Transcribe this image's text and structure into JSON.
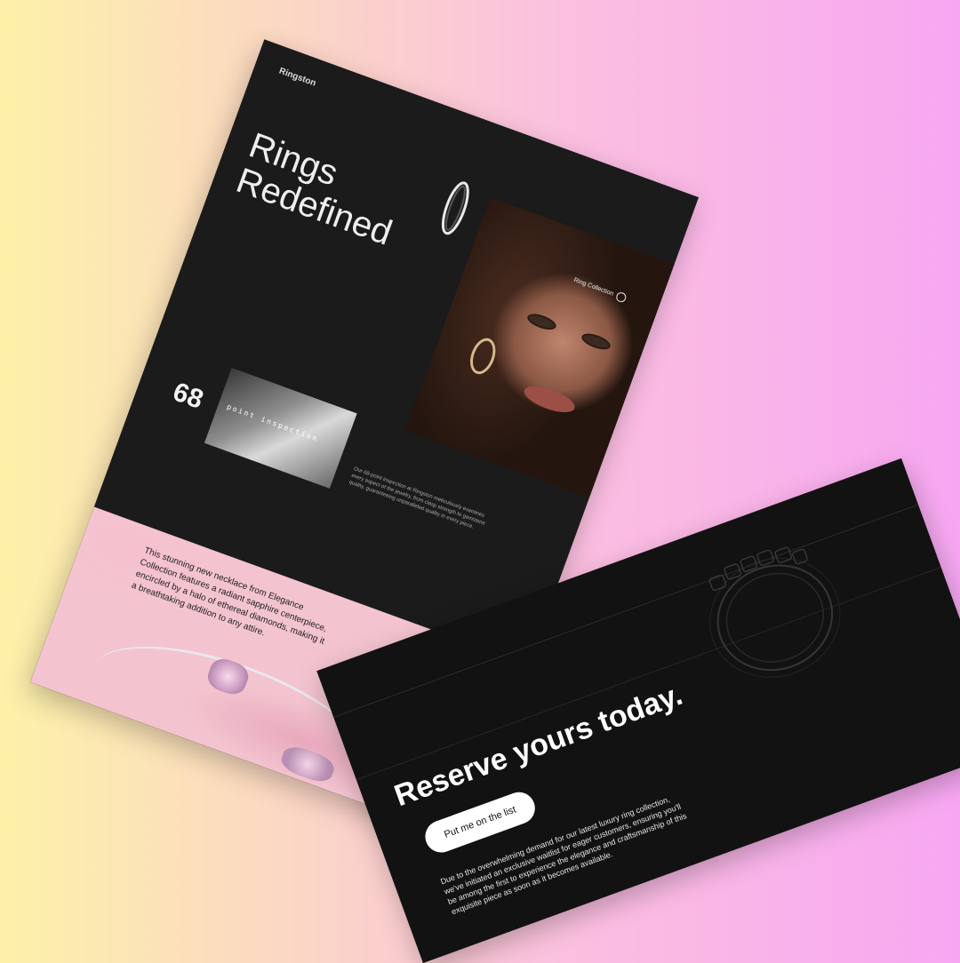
{
  "brand": "Ringston",
  "hero": {
    "title_line1": "Rings",
    "title_line2": "Redefined",
    "collection_label": "Ring Collection"
  },
  "inspection": {
    "number": "68",
    "image_label": "point inspection",
    "description": "Our 68-point inspection at Ringston meticulously examines every aspect of the jewelry, from clasp strength to gemstone quality, guaranteeing unparalleled quality in every piece."
  },
  "promo": {
    "text": "This stunning new necklace from Elegance Collection features a radiant sapphire centerpiece, encircled by a halo of ethereal diamonds, making it a breathtaking addition to any attire."
  },
  "reserve": {
    "title": "Reserve yours today.",
    "button_label": "Put me on the list",
    "description": "Due to the overwhelming demand for our latest luxury ring collection, we've initiated an exclusive waitlist for eager customers, ensuring you'll be among the first to experience the elegance and craftsmanship of this exquisite piece as soon as it becomes available."
  }
}
